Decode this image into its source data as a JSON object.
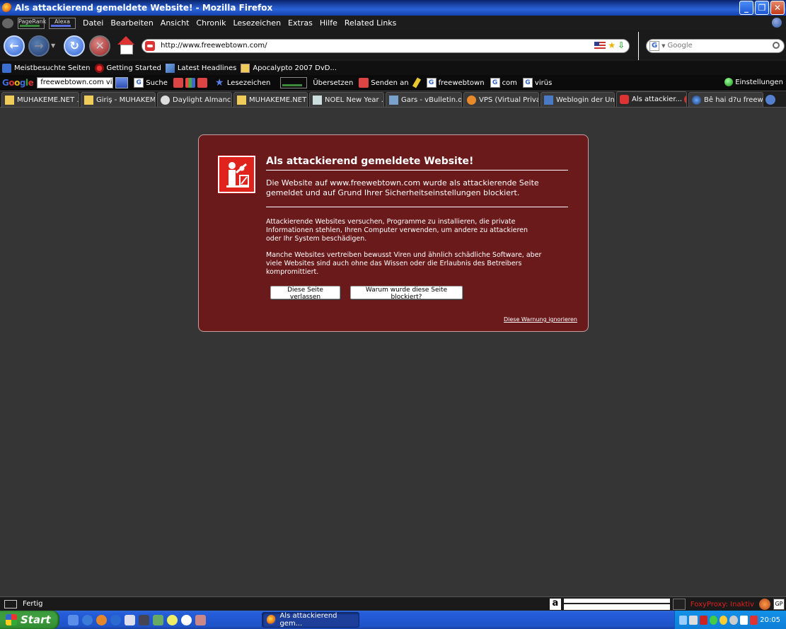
{
  "window": {
    "title": "Als attackierend gemeldete Website! - Mozilla Firefox",
    "controls": [
      "_",
      "❐",
      "✕"
    ]
  },
  "menubar": {
    "pagerank_label": "PageRank",
    "alexa_label": "Alexa",
    "items": [
      "Datei",
      "Bearbeiten",
      "Ansicht",
      "Chronik",
      "Lesezeichen",
      "Extras",
      "Hilfe",
      "Related Links"
    ]
  },
  "navbar": {
    "url": "http://www.freewebtown.com/",
    "search_placeholder": "Google"
  },
  "bookmarks": [
    "Meistbesuchte Seiten",
    "Getting Started",
    "Latest Headlines",
    "Apocalypto 2007 DvD..."
  ],
  "google_toolbar": {
    "query": "freewebtown.com virüs",
    "search_label": "Suche",
    "lesezeichen_label": "Lesezeichen",
    "translate_label": "Übersetzen",
    "send_label": "Senden an",
    "highlight_terms": [
      "freewebtown",
      "com",
      "virüs"
    ],
    "settings_label": "Einstellungen"
  },
  "tabs": [
    {
      "label": "MUHAKEME.NET ...",
      "icon": "mu",
      "active": false
    },
    {
      "label": "Giriş - MUHAKEM...",
      "icon": "mu",
      "active": false
    },
    {
      "label": "Daylight Almanca...",
      "icon": "skull",
      "active": false
    },
    {
      "label": "MUHAKEME.NET ...",
      "icon": "mu",
      "active": false
    },
    {
      "label": "NOEL New Year ...",
      "icon": "noel",
      "active": false
    },
    {
      "label": "Gars - vBulletin.o...",
      "icon": "gars",
      "active": false
    },
    {
      "label": "VPS (Virtual Priva...",
      "icon": "vps",
      "active": false
    },
    {
      "label": "Weblogin der Uni...",
      "icon": "web",
      "active": false
    },
    {
      "label": "Als attackier...",
      "icon": "block",
      "active": true
    },
    {
      "label": "Bê hai d?u freew...",
      "icon": "earth",
      "active": false
    }
  ],
  "warning": {
    "title": "Als attackierend gemeldete Website!",
    "intro": "Die Website auf www.freewebtown.com wurde als attackierende Seite gemeldet und auf Grund Ihrer Sicherheitseinstellungen blockiert.",
    "paragraph1": "Attackierende Websites versuchen, Programme zu installieren, die private Informationen stehlen, Ihren Computer verwenden, um andere zu attackieren oder Ihr System beschädigen.",
    "paragraph2": "Manche Websites vertreiben bewusst Viren und ähnlich schädliche Software, aber viele Websites sind auch ohne das Wissen oder die Erlaubnis des Betreibers kompromittiert.",
    "leave_button": "Diese Seite verlassen",
    "why_button": "Warum wurde diese Seite blockiert?",
    "ignore_link": "Diese Warnung ignorieren"
  },
  "statusbar": {
    "status": "Fertig",
    "foxyproxy": "FoxyProxy: Inaktiv",
    "gp_label": "GP",
    "amazon_label": "a"
  },
  "taskbar": {
    "start_label": "Start",
    "task_label": "Als attackierend gem...",
    "clock": "20:05"
  },
  "colors": {
    "warning_bg": "#6b1a1b",
    "page_bg": "#353535",
    "foxyproxy_text": "#e02020"
  }
}
